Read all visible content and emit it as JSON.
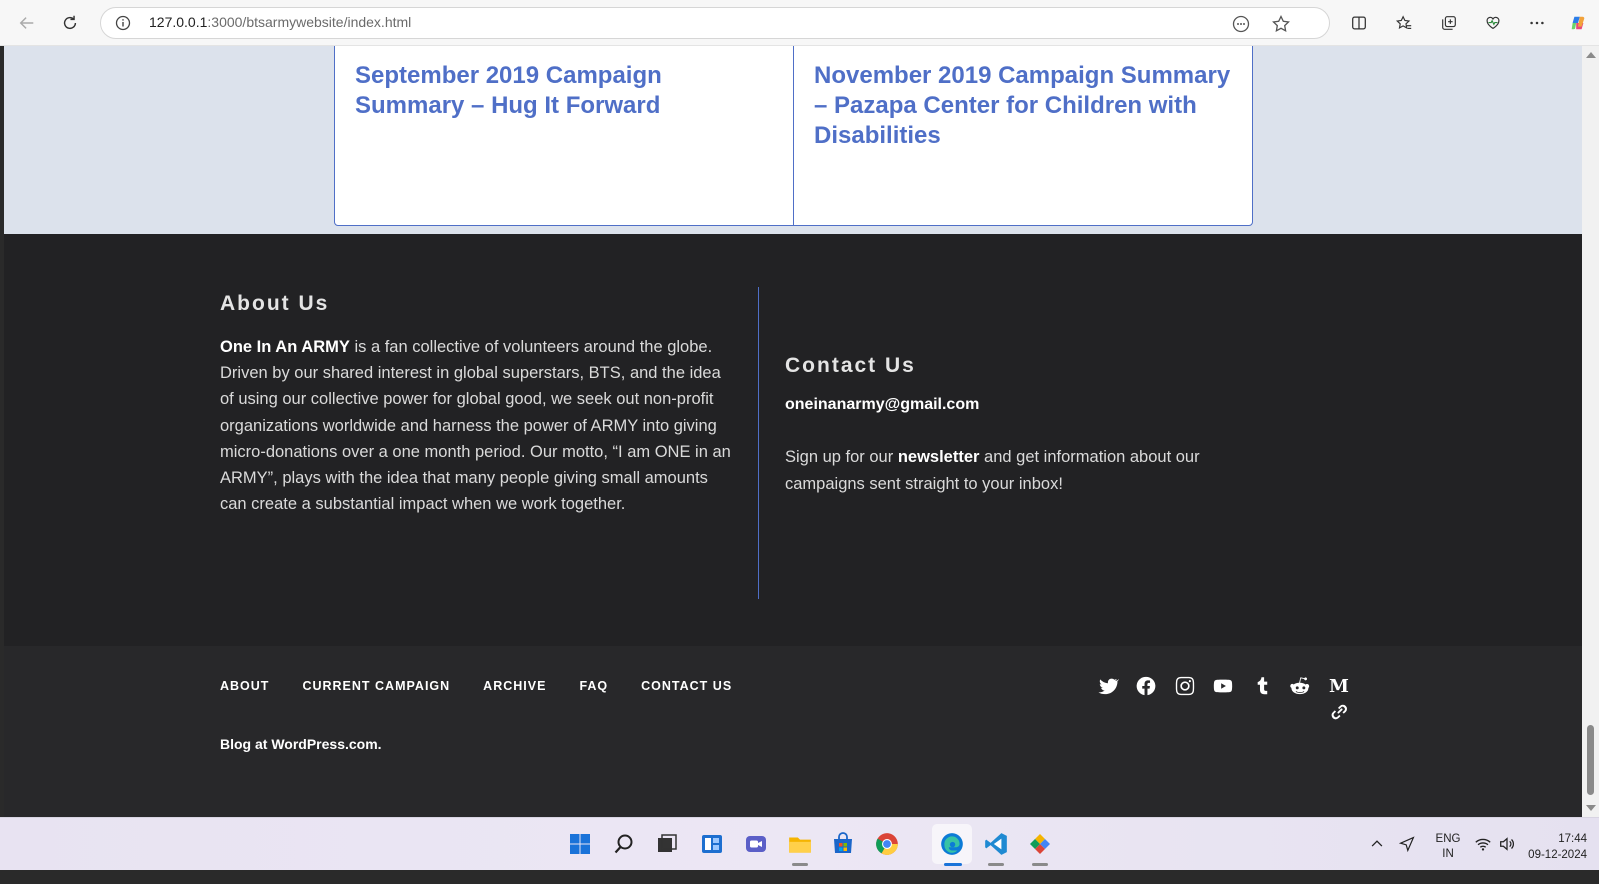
{
  "browser": {
    "url_host": "127.0.0.1",
    "url_rest": ":3000/btsarmywebsite/index.html"
  },
  "cards": [
    {
      "title": "September 2019 Campaign Summary – Hug It Forward"
    },
    {
      "title": "November 2019 Campaign Summary – Pazapa Center for Children with Disabilities"
    }
  ],
  "about": {
    "heading": "About Us",
    "org_name": "One In An ARMY",
    "text": " is a fan collective of volunteers around the globe. Driven by our shared interest in global superstars, BTS, and the idea of using our collective power for global good, we seek out non-profit organizations worldwide and harness the power of ARMY into giving micro-donations over a one month period. Our motto, “I am ONE in an ARMY”, plays with the idea that many people giving small amounts can create a substantial impact when we work together."
  },
  "contact": {
    "heading": "Contact Us",
    "email": "oneinanarmy@gmail.com",
    "signup_before": "Sign up for our ",
    "signup_link": "newsletter",
    "signup_after": " and get information about our campaigns sent straight to your inbox!"
  },
  "footer_nav": [
    "ABOUT",
    "CURRENT CAMPAIGN",
    "ARCHIVE",
    "FAQ",
    "CONTACT US"
  ],
  "social_icons": [
    "twitter-icon",
    "facebook-icon",
    "instagram-icon",
    "youtube-icon",
    "tumblr-icon",
    "reddit-icon",
    "medium-icon",
    "link-icon"
  ],
  "credit": "Blog at WordPress.com.",
  "taskbar": {
    "lang_top": "ENG",
    "lang_bottom": "IN",
    "time": "17:44",
    "date": "09-12-2024"
  }
}
